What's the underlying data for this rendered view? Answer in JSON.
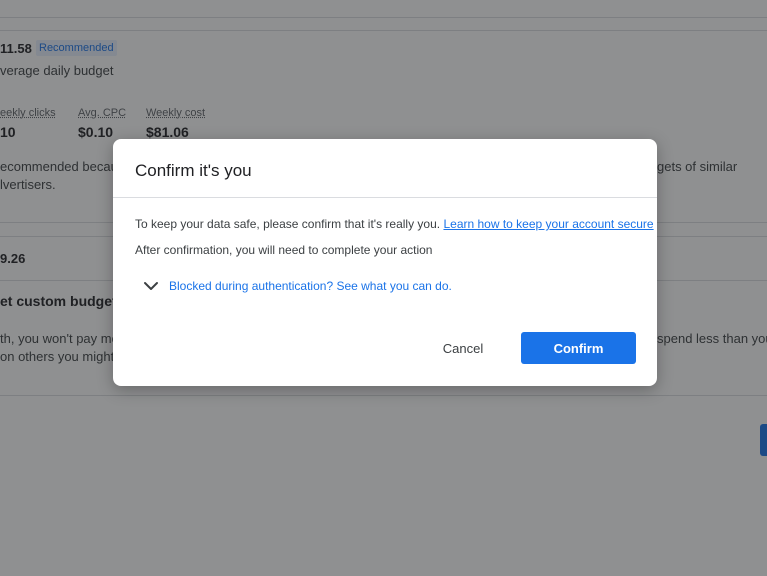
{
  "background": {
    "top_amount": "11.58",
    "recommended_badge": "Recommended",
    "average_daily_budget": "verage daily budget",
    "stats": [
      {
        "label": "eekly clicks",
        "value": "10"
      },
      {
        "label": "Avg. CPC",
        "value": "$0.10"
      },
      {
        "label": "Weekly cost",
        "value": "$81.06"
      }
    ],
    "recommended_text_left": "ecommended becau",
    "recommended_text_right": "gets of similar",
    "advertisers_text": "lvertisers.",
    "amount_two": "9.26",
    "custom_budget_heading": "et custom budget",
    "custom_text_left_1": "th, you won't pay mo",
    "custom_text_right_1": "spend less than you",
    "custom_text_left_2": "on others you might"
  },
  "dialog": {
    "title": "Confirm it's you",
    "message_prefix": "To keep your data safe, please confirm that it's really you.",
    "learn_link": "Learn how to keep your account secure",
    "after_confirmation": "After confirmation, you will need to complete your action",
    "blocked_expander": "Blocked during authentication? See what you can do.",
    "cancel_label": "Cancel",
    "confirm_label": "Confirm"
  },
  "colors": {
    "accent": "#1a73e8",
    "scrim": "rgba(32,33,36,0.5)"
  }
}
